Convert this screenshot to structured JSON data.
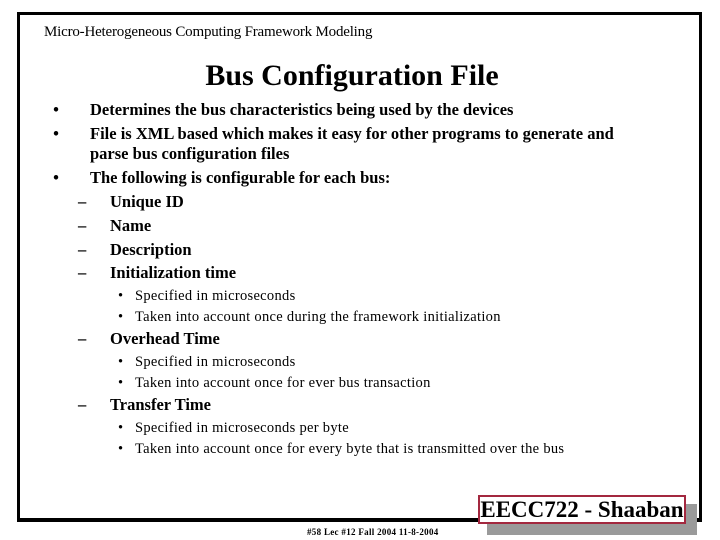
{
  "slide": {
    "header": "Micro-Heterogeneous Computing Framework Modeling",
    "title": "Bus Configuration File",
    "bullets": [
      {
        "marker": "•",
        "lines": [
          "Determines the bus characteristics being used by the devices"
        ]
      },
      {
        "marker": "•",
        "lines": [
          "File is XML based which makes it easy for other programs to generate and",
          "parse bus configuration files"
        ]
      },
      {
        "marker": "•",
        "lines": [
          "The following is configurable for each bus:"
        ]
      }
    ],
    "sub_items": [
      {
        "marker": "–",
        "label": "Unique ID",
        "details": []
      },
      {
        "marker": "–",
        "label": "Name",
        "details": []
      },
      {
        "marker": "–",
        "label": "Description",
        "details": []
      },
      {
        "marker": "–",
        "label": "Initialization time",
        "details": [
          "Specified in microseconds",
          "Taken into account once during the framework initialization"
        ]
      },
      {
        "marker": "–",
        "label": "Overhead Time",
        "details": [
          "Specified in microseconds",
          "Taken into account once for ever bus transaction"
        ]
      },
      {
        "marker": "–",
        "label": "Transfer Time",
        "details": [
          "Specified in microseconds per byte",
          "Taken into account once for every byte that is transmitted over the bus"
        ]
      }
    ],
    "detail_marker": "•",
    "footer": "#58   Lec #12   Fall 2004  11-8-2004",
    "badge": "EECC722 - Shaaban",
    "colors": {
      "badge_border": "#a3283f",
      "badge_shadow": "#9a9a9a",
      "frame": "#000000"
    }
  }
}
